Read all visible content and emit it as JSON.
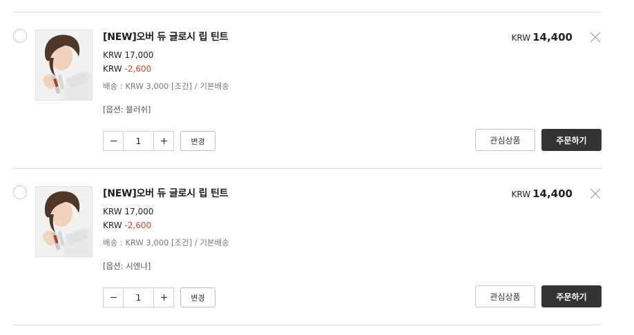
{
  "items": [
    {
      "name": "[NEW]오버 듀 글로시 립 틴트",
      "currency": "KRW",
      "original_price": "17,000",
      "discount": "-2,600",
      "shipping": "배송 : KRW 3,000 [조건] / 기본배송",
      "option": "[옵션: 블러쉬]",
      "quantity": "1",
      "change_label": "변경",
      "total_currency": "KRW",
      "total_amount": "14,400",
      "wishlist_label": "관심상품",
      "order_label": "주문하기"
    },
    {
      "name": "[NEW]오버 듀 글로시 립 틴트",
      "currency": "KRW",
      "original_price": "17,000",
      "discount": "-2,600",
      "shipping": "배송 : KRW 3,000 [조건] / 기본배송",
      "option": "[옵션: 시엔나]",
      "quantity": "1",
      "change_label": "변경",
      "total_currency": "KRW",
      "total_amount": "14,400",
      "wishlist_label": "관심상품",
      "order_label": "주문하기"
    }
  ],
  "icons": {
    "select": "radio-icon",
    "decrease": "minus-icon",
    "increase": "plus-icon",
    "remove": "close-icon",
    "product": "product-photo"
  },
  "colors": {
    "discount": "#d5472b",
    "order_button": "#333333",
    "divider": "#dcdcdc"
  }
}
